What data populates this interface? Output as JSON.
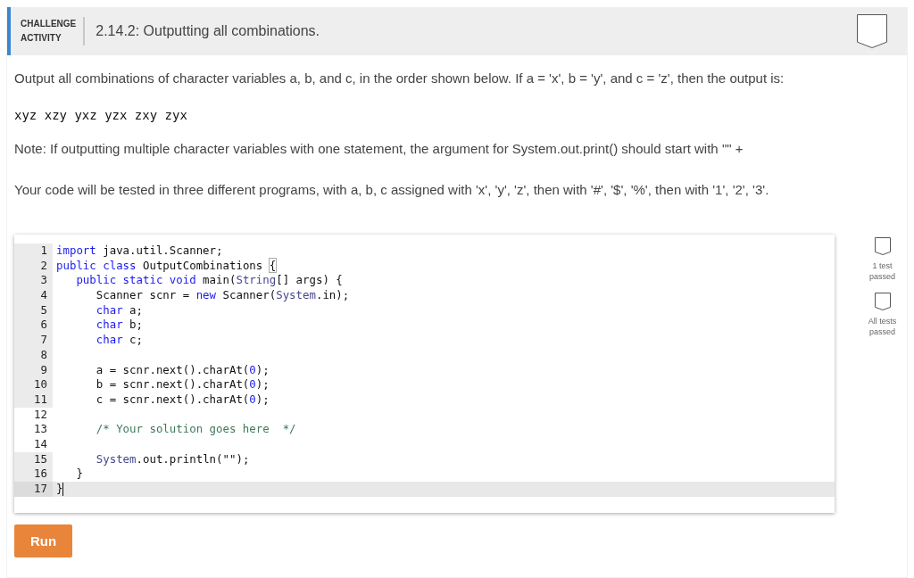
{
  "header": {
    "label_line_1": "CHALLENGE",
    "label_line_2": "ACTIVITY",
    "title": "2.14.2: Outputting all combinations.",
    "completed": false
  },
  "instructions": [
    {
      "kind": "text",
      "text": "Output all combinations of character variables a, b, and c, in the order shown below. If a = 'x', b = 'y', and c = 'z', then the output is:"
    },
    {
      "kind": "code",
      "text": "xyz xzy yxz yzx zxy zyx"
    },
    {
      "kind": "text",
      "text": "Note: If outputting multiple character variables with one statement, the argument for System.out.print() should start with \"\" +"
    },
    {
      "kind": "text",
      "text": "Your code will be tested in three different programs, with a, b, c assigned with 'x', 'y', 'z', then with '#', '$', '%', then with '1', '2', '3'."
    }
  ],
  "editor": {
    "lines": [
      {
        "number": "1",
        "editable": false,
        "active": false,
        "tokens": [
          {
            "kind": "keyword",
            "text": "import"
          },
          {
            "kind": "plain",
            "text": " java.util.Scanner;"
          }
        ]
      },
      {
        "number": "2",
        "editable": false,
        "active": false,
        "tokens": [
          {
            "kind": "keyword",
            "text": "public class"
          },
          {
            "kind": "plain",
            "text": " OutputCombinations "
          },
          {
            "kind": "bracket",
            "text": "{"
          }
        ]
      },
      {
        "number": "3",
        "editable": false,
        "active": false,
        "tokens": [
          {
            "kind": "keyword",
            "text": "   public static void"
          },
          {
            "kind": "plain",
            "text": " main("
          },
          {
            "kind": "type",
            "text": "String"
          },
          {
            "kind": "plain",
            "text": "[] args) {"
          }
        ]
      },
      {
        "number": "4",
        "editable": false,
        "active": false,
        "tokens": [
          {
            "kind": "plain",
            "text": "      Scanner scnr = "
          },
          {
            "kind": "keyword",
            "text": "new"
          },
          {
            "kind": "plain",
            "text": " Scanner("
          },
          {
            "kind": "type",
            "text": "System"
          },
          {
            "kind": "plain",
            "text": ".in);"
          }
        ]
      },
      {
        "number": "5",
        "editable": false,
        "active": false,
        "tokens": [
          {
            "kind": "keyword",
            "text": "      char"
          },
          {
            "kind": "plain",
            "text": " a;"
          }
        ]
      },
      {
        "number": "6",
        "editable": false,
        "active": false,
        "tokens": [
          {
            "kind": "keyword",
            "text": "      char"
          },
          {
            "kind": "plain",
            "text": " b;"
          }
        ]
      },
      {
        "number": "7",
        "editable": false,
        "active": false,
        "tokens": [
          {
            "kind": "keyword",
            "text": "      char"
          },
          {
            "kind": "plain",
            "text": " c;"
          }
        ]
      },
      {
        "number": "8",
        "editable": false,
        "active": false
      },
      {
        "number": "9",
        "editable": false,
        "active": false,
        "tokens": [
          {
            "kind": "plain",
            "text": "      a = scnr.next().charAt("
          },
          {
            "kind": "number",
            "text": "0"
          },
          {
            "kind": "plain",
            "text": ");"
          }
        ]
      },
      {
        "number": "10",
        "editable": false,
        "active": false,
        "tokens": [
          {
            "kind": "plain",
            "text": "      b = scnr.next().charAt("
          },
          {
            "kind": "number",
            "text": "0"
          },
          {
            "kind": "plain",
            "text": ");"
          }
        ]
      },
      {
        "number": "11",
        "editable": false,
        "active": false,
        "tokens": [
          {
            "kind": "plain",
            "text": "      c = scnr.next().charAt("
          },
          {
            "kind": "number",
            "text": "0"
          },
          {
            "kind": "plain",
            "text": ");"
          }
        ]
      },
      {
        "number": "12",
        "editable": true,
        "active": false
      },
      {
        "number": "13",
        "editable": true,
        "active": false,
        "tokens": [
          {
            "kind": "comment",
            "text": "      /* Your solution goes here  */"
          }
        ]
      },
      {
        "number": "14",
        "editable": true,
        "active": false
      },
      {
        "number": "15",
        "editable": false,
        "active": false,
        "tokens": [
          {
            "kind": "type",
            "text": "      System"
          },
          {
            "kind": "plain",
            "text": ".out.println(\"\");"
          }
        ]
      },
      {
        "number": "16",
        "editable": false,
        "active": false,
        "tokens": [
          {
            "kind": "plain",
            "text": "   }"
          }
        ]
      },
      {
        "number": "17",
        "editable": false,
        "active": true,
        "tokens": [
          {
            "kind": "plain",
            "text": "}"
          }
        ]
      }
    ]
  },
  "tests": [
    {
      "label_line_1": "1 test",
      "label_line_2": "passed",
      "passed": false
    },
    {
      "label_line_1": "All tests",
      "label_line_2": "passed",
      "passed": false
    }
  ],
  "run_button": {
    "label": "Run"
  }
}
